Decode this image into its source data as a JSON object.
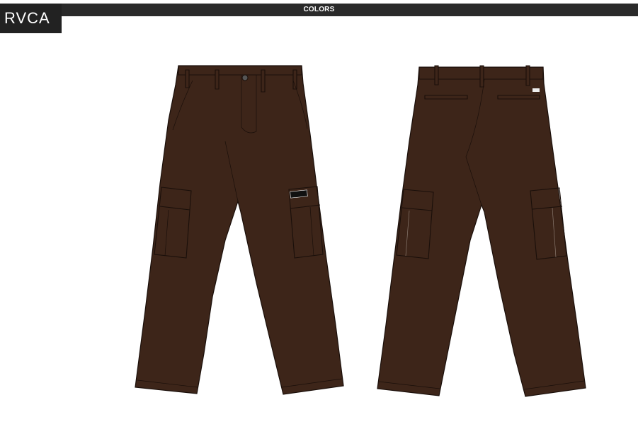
{
  "brand": {
    "logo_text": "RVCA"
  },
  "header": {
    "title": "COLORS"
  },
  "garment": {
    "fill_color": "#3d2519",
    "outline_color": "#1a0f0a",
    "views": [
      "front-view",
      "back-view"
    ],
    "label_text": "RVCA"
  }
}
